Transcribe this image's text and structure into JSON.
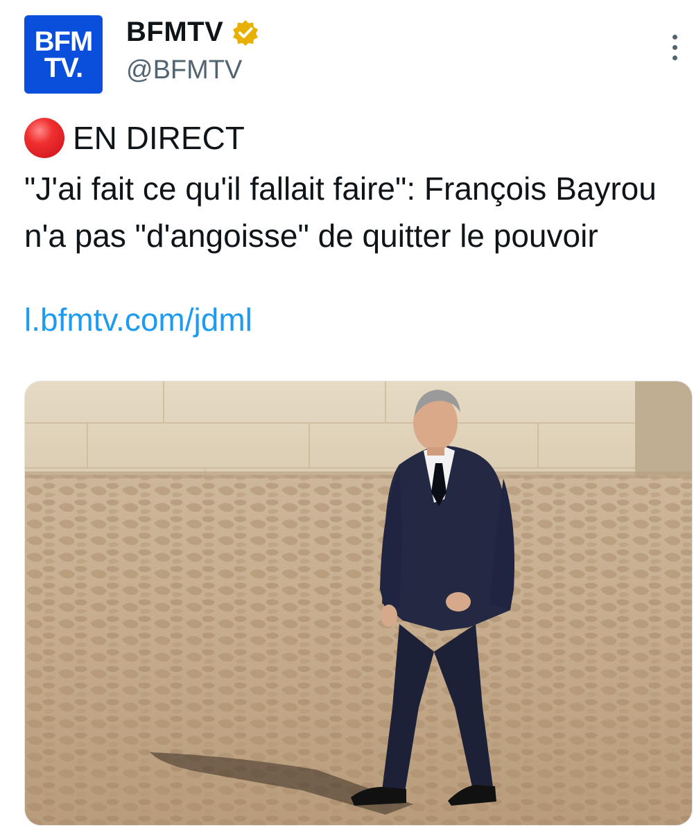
{
  "account": {
    "avatar_line1": "BFM",
    "avatar_line2": "TV.",
    "name": "BFMTV",
    "handle": "@BFMTV",
    "verified_color": "#e8b000",
    "avatar_color": "#0a4fdc"
  },
  "post": {
    "live_label": "EN DIRECT",
    "live_icon": "red-circle-icon",
    "headline": "\"J'ai fait ce qu'il fallait faire\": François Bayrou n'a pas \"d'angoisse\" de quitter le pouvoir",
    "link": "l.bfmtv.com/jdml",
    "link_color": "#1d9bf0"
  },
  "menu_icon": "more-vertical-icon"
}
